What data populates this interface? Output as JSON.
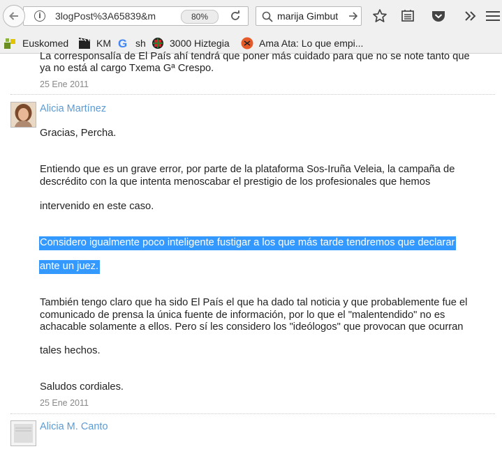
{
  "browser": {
    "url": "3logPost%3A65839&m",
    "zoom": "80%",
    "search_query": "marija Gimbut"
  },
  "bookmarks": [
    {
      "label": "Euskomed"
    },
    {
      "label": "KM"
    },
    {
      "label": "sh"
    },
    {
      "label": "3000 Hiztegia"
    },
    {
      "label": "Ama Ata: Lo que empi..."
    }
  ],
  "comments": {
    "previous": {
      "line1": "La corresponsalía de El País ahí tendrá que poner más cuidado para que no se note tanto que",
      "line2": "ya no está al cargo Txema Gª Crespo.",
      "date": "25 Ene 2011"
    },
    "main": {
      "author": "Alicia Martínez",
      "greeting": "Gracias, Percha.",
      "p1_l1": "Entiendo que es un grave error, por parte de la plataforma Sos-Iruña Veleia, la campaña de",
      "p1_l2": "descrédito con la que intenta menoscabar el prestigio de los profesionales que hemos",
      "p1_l3": "intervenido en este caso.",
      "p2_l1": "Considero igualmente poco inteligente fustigar a los que más tarde tendremos que declarar",
      "p2_l2": "ante un juez.",
      "p3_l1": "También tengo claro que ha sido El País el que ha dado tal noticia y que probablemente fue el",
      "p3_l2": "comunicado de prensa la única fuente de información, por lo que el \"malentendido\" no es",
      "p3_l3": "achacable solamente a ellos. Pero sí les considero los \"ideólogos\" que provocan que ocurran",
      "p3_l4": "tales hechos.",
      "closing": "Saludos cordiales.",
      "date": "25 Ene 2011"
    },
    "next": {
      "author": "Alicia M. Canto"
    }
  }
}
